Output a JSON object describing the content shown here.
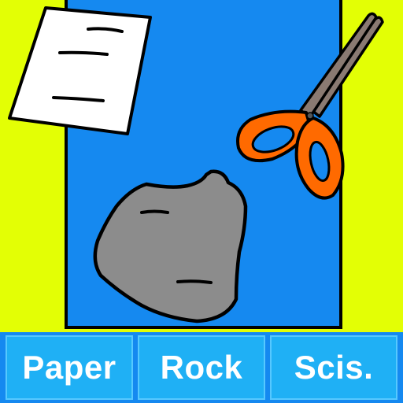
{
  "buttons": {
    "paper_label": "Paper",
    "rock_label": "Rock",
    "scissors_label": "Scis."
  },
  "colors": {
    "background": "#e3ff05",
    "play_area": "#1589f0",
    "button_fill": "#1fb0f5",
    "button_text": "#ffffff",
    "rock": "#8c8c8c",
    "scissors_handles": "#ff6a00",
    "scissors_blades": "#8a7a72",
    "paper": "#ffffff"
  },
  "icons": {
    "paper": "paper-sheet-icon",
    "rock": "rock-icon",
    "scissors": "scissors-icon"
  }
}
